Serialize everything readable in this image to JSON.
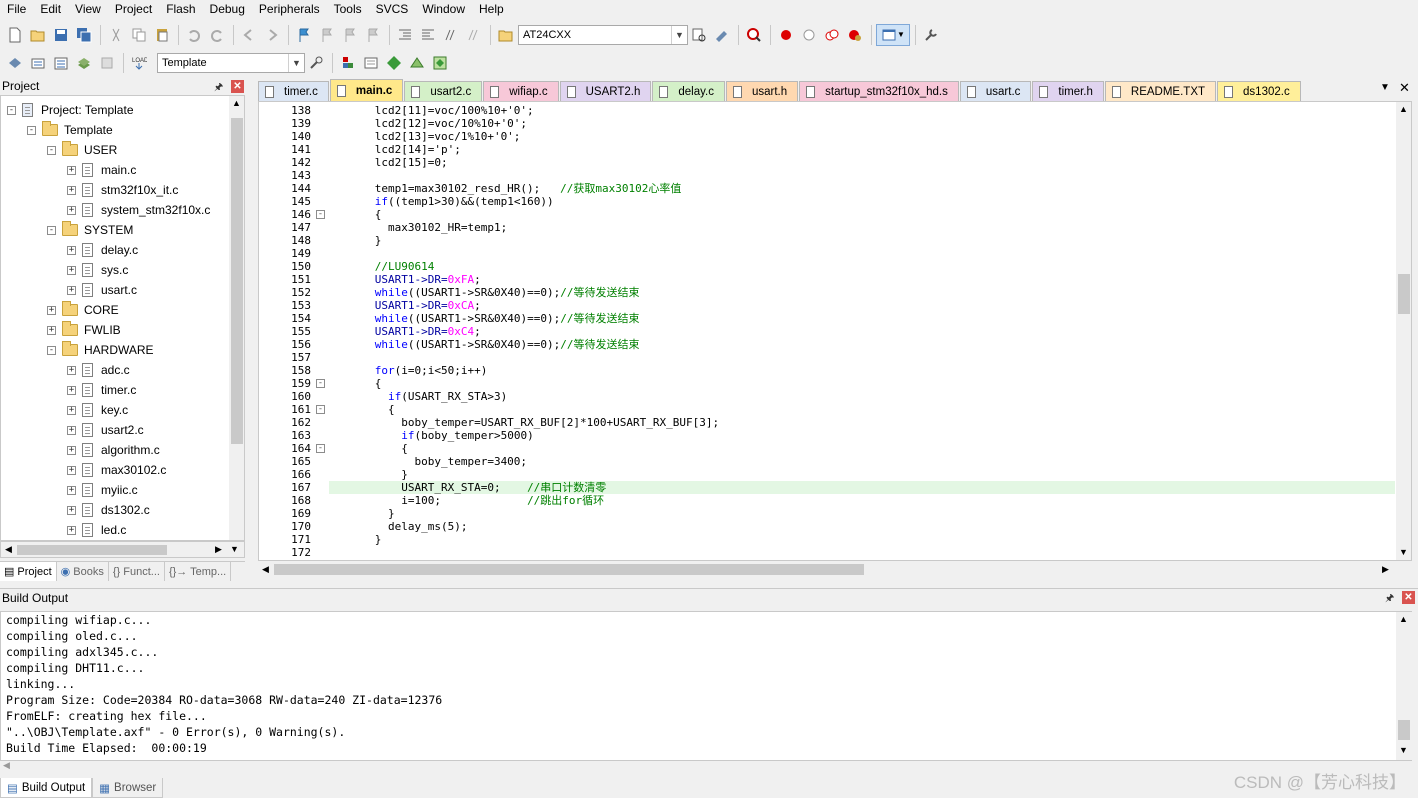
{
  "menu": [
    "File",
    "Edit",
    "View",
    "Project",
    "Flash",
    "Debug",
    "Peripherals",
    "Tools",
    "SVCS",
    "Window",
    "Help"
  ],
  "toolbar": {
    "target_combo": "AT24CXX",
    "template_combo": "Template"
  },
  "project_panel": {
    "title": "Project",
    "tree": [
      {
        "label": "Project: Template",
        "level": 0,
        "type": "root",
        "exp": "-"
      },
      {
        "label": "Template",
        "level": 1,
        "type": "target",
        "exp": "-"
      },
      {
        "label": "USER",
        "level": 2,
        "type": "folder",
        "exp": "-"
      },
      {
        "label": "main.c",
        "level": 3,
        "type": "file",
        "exp": "+"
      },
      {
        "label": "stm32f10x_it.c",
        "level": 3,
        "type": "file",
        "exp": "+"
      },
      {
        "label": "system_stm32f10x.c",
        "level": 3,
        "type": "file",
        "exp": "+"
      },
      {
        "label": "SYSTEM",
        "level": 2,
        "type": "folder",
        "exp": "-"
      },
      {
        "label": "delay.c",
        "level": 3,
        "type": "file",
        "exp": "+"
      },
      {
        "label": "sys.c",
        "level": 3,
        "type": "file",
        "exp": "+"
      },
      {
        "label": "usart.c",
        "level": 3,
        "type": "file",
        "exp": "+"
      },
      {
        "label": "CORE",
        "level": 2,
        "type": "folder",
        "exp": "+"
      },
      {
        "label": "FWLIB",
        "level": 2,
        "type": "folder",
        "exp": "+"
      },
      {
        "label": "HARDWARE",
        "level": 2,
        "type": "folder",
        "exp": "-"
      },
      {
        "label": "adc.c",
        "level": 3,
        "type": "file",
        "exp": "+"
      },
      {
        "label": "timer.c",
        "level": 3,
        "type": "file",
        "exp": "+"
      },
      {
        "label": "key.c",
        "level": 3,
        "type": "file",
        "exp": "+"
      },
      {
        "label": "usart2.c",
        "level": 3,
        "type": "file",
        "exp": "+"
      },
      {
        "label": "algorithm.c",
        "level": 3,
        "type": "file",
        "exp": "+"
      },
      {
        "label": "max30102.c",
        "level": 3,
        "type": "file",
        "exp": "+"
      },
      {
        "label": "myiic.c",
        "level": 3,
        "type": "file",
        "exp": "+"
      },
      {
        "label": "ds1302.c",
        "level": 3,
        "type": "file",
        "exp": "+"
      },
      {
        "label": "led.c",
        "level": 3,
        "type": "file",
        "exp": "+"
      }
    ],
    "bottom_tabs": [
      "Project",
      "Books",
      "{} Funct...",
      "{}→ Temp..."
    ]
  },
  "file_tabs": [
    {
      "label": "timer.c",
      "color": "#dce6f4",
      "active": false
    },
    {
      "label": "main.c",
      "color": "#ffe88a",
      "active": true
    },
    {
      "label": "usart2.c",
      "color": "#d4f0c8",
      "active": false
    },
    {
      "label": "wifiap.c",
      "color": "#f7c8d8",
      "active": false
    },
    {
      "label": "USART2.h",
      "color": "#e0d4f0",
      "active": false
    },
    {
      "label": "delay.c",
      "color": "#d4f0c8",
      "active": false
    },
    {
      "label": "usart.h",
      "color": "#ffd8b0",
      "active": false
    },
    {
      "label": "startup_stm32f10x_hd.s",
      "color": "#f7c8d8",
      "active": false
    },
    {
      "label": "usart.c",
      "color": "#dce6f4",
      "active": false
    },
    {
      "label": "timer.h",
      "color": "#e0d4f0",
      "active": false
    },
    {
      "label": "README.TXT",
      "color": "#ffe8c8",
      "active": false
    },
    {
      "label": "ds1302.c",
      "color": "#ffef9a",
      "active": false
    }
  ],
  "editor": {
    "highlight_line": 167,
    "lines": [
      {
        "n": "138",
        "f": "",
        "t": [
          [
            "      lcd2[11]=voc/100%10+'0';",
            ""
          ]
        ]
      },
      {
        "n": "139",
        "f": "",
        "t": [
          [
            "      lcd2[12]=voc/10%10+'0';",
            ""
          ]
        ]
      },
      {
        "n": "140",
        "f": "",
        "t": [
          [
            "      lcd2[13]=voc/1%10+'0';",
            ""
          ]
        ]
      },
      {
        "n": "141",
        "f": "",
        "t": [
          [
            "      lcd2[14]='p';",
            ""
          ]
        ]
      },
      {
        "n": "142",
        "f": "",
        "t": [
          [
            "      lcd2[15]=0;",
            ""
          ]
        ]
      },
      {
        "n": "143",
        "f": "",
        "t": [
          [
            "",
            ""
          ]
        ]
      },
      {
        "n": "144",
        "f": "",
        "t": [
          [
            "      temp1=max30102_resd_HR();   ",
            ""
          ],
          [
            "//获取max30102心率值",
            "cmt"
          ]
        ]
      },
      {
        "n": "145",
        "f": "",
        "t": [
          [
            "      ",
            ""
          ],
          [
            "if",
            "kw"
          ],
          [
            "((temp1>30)&&(temp1<160))",
            ""
          ]
        ]
      },
      {
        "n": "146",
        "f": "-",
        "t": [
          [
            "      {",
            ""
          ]
        ]
      },
      {
        "n": "147",
        "f": "",
        "t": [
          [
            "        max30102_HR=temp1;",
            ""
          ]
        ]
      },
      {
        "n": "148",
        "f": "",
        "t": [
          [
            "      }",
            ""
          ]
        ]
      },
      {
        "n": "149",
        "f": "",
        "t": [
          [
            "",
            ""
          ]
        ]
      },
      {
        "n": "150",
        "f": "",
        "t": [
          [
            "      //LU90614",
            "cmt"
          ]
        ]
      },
      {
        "n": "151",
        "f": "",
        "t": [
          [
            "      USART1->DR=",
            "mac"
          ],
          [
            "0xFA",
            "num"
          ],
          [
            ";",
            ""
          ]
        ]
      },
      {
        "n": "152",
        "f": "",
        "t": [
          [
            "      ",
            ""
          ],
          [
            "while",
            "kw"
          ],
          [
            "((USART1->SR&0X40)==0);",
            ""
          ],
          [
            "//等待发送结束",
            "cmt"
          ]
        ]
      },
      {
        "n": "153",
        "f": "",
        "t": [
          [
            "      USART1->DR=",
            "mac"
          ],
          [
            "0xCA",
            "num"
          ],
          [
            ";",
            ""
          ]
        ]
      },
      {
        "n": "154",
        "f": "",
        "t": [
          [
            "      ",
            ""
          ],
          [
            "while",
            "kw"
          ],
          [
            "((USART1->SR&0X40)==0);",
            ""
          ],
          [
            "//等待发送结束",
            "cmt"
          ]
        ]
      },
      {
        "n": "155",
        "f": "",
        "t": [
          [
            "      USART1->DR=",
            "mac"
          ],
          [
            "0xC4",
            "num"
          ],
          [
            ";",
            ""
          ]
        ]
      },
      {
        "n": "156",
        "f": "",
        "t": [
          [
            "      ",
            ""
          ],
          [
            "while",
            "kw"
          ],
          [
            "((USART1->SR&0X40)==0);",
            ""
          ],
          [
            "//等待发送结束",
            "cmt"
          ]
        ]
      },
      {
        "n": "157",
        "f": "",
        "t": [
          [
            "",
            ""
          ]
        ]
      },
      {
        "n": "158",
        "f": "",
        "t": [
          [
            "      ",
            ""
          ],
          [
            "for",
            "kw"
          ],
          [
            "(i=0;i<50;i++)",
            ""
          ]
        ]
      },
      {
        "n": "159",
        "f": "-",
        "t": [
          [
            "      {",
            ""
          ]
        ]
      },
      {
        "n": "160",
        "f": "",
        "t": [
          [
            "        ",
            ""
          ],
          [
            "if",
            "kw"
          ],
          [
            "(USART_RX_STA>3)",
            ""
          ]
        ]
      },
      {
        "n": "161",
        "f": "-",
        "t": [
          [
            "        {",
            ""
          ]
        ]
      },
      {
        "n": "162",
        "f": "",
        "t": [
          [
            "          boby_temper=USART_RX_BUF[2]*100+USART_RX_BUF[3];",
            ""
          ]
        ]
      },
      {
        "n": "163",
        "f": "",
        "t": [
          [
            "          ",
            ""
          ],
          [
            "if",
            "kw"
          ],
          [
            "(boby_temper>5000)",
            ""
          ]
        ]
      },
      {
        "n": "164",
        "f": "-",
        "t": [
          [
            "          {",
            ""
          ]
        ]
      },
      {
        "n": "165",
        "f": "",
        "t": [
          [
            "            boby_temper=3400;",
            ""
          ]
        ]
      },
      {
        "n": "166",
        "f": "",
        "t": [
          [
            "          }",
            ""
          ]
        ]
      },
      {
        "n": "167",
        "f": "",
        "t": [
          [
            "          USART_RX_STA=0;    ",
            ""
          ],
          [
            "//串口计数清零",
            "cmt"
          ]
        ]
      },
      {
        "n": "168",
        "f": "",
        "t": [
          [
            "          i=100;             ",
            ""
          ],
          [
            "//跳出for循环",
            "cmt"
          ]
        ]
      },
      {
        "n": "169",
        "f": "",
        "t": [
          [
            "        }",
            ""
          ]
        ]
      },
      {
        "n": "170",
        "f": "",
        "t": [
          [
            "        delay_ms(5);",
            ""
          ]
        ]
      },
      {
        "n": "171",
        "f": "",
        "t": [
          [
            "      }",
            ""
          ]
        ]
      },
      {
        "n": "172",
        "f": "",
        "t": [
          [
            "",
            ""
          ]
        ]
      }
    ]
  },
  "build_output": {
    "title": "Build Output",
    "lines": [
      "compiling wifiap.c...",
      "compiling oled.c...",
      "compiling adxl345.c...",
      "compiling DHT11.c...",
      "linking...",
      "Program Size: Code=20384 RO-data=3068 RW-data=240 ZI-data=12376",
      "FromELF: creating hex file...",
      "\"..\\OBJ\\Template.axf\" - 0 Error(s), 0 Warning(s).",
      "Build Time Elapsed:  00:00:19"
    ]
  },
  "bottom_tabs": [
    "Build Output",
    "Browser"
  ],
  "watermark": "CSDN @【芳心科技】"
}
